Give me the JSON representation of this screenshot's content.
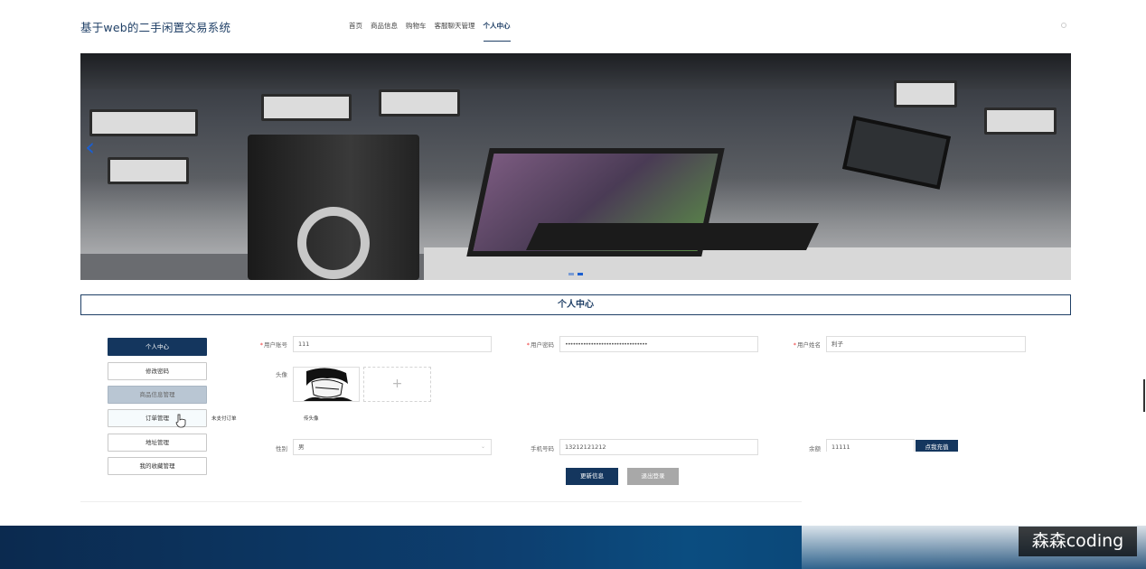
{
  "header": {
    "site_title": "基于web的二手闲置交易系统",
    "nav": [
      {
        "label": "首页"
      },
      {
        "label": "商品信息"
      },
      {
        "label": "购物车"
      },
      {
        "label": "客服聊天管理"
      },
      {
        "label": "个人中心"
      }
    ],
    "active_nav": "个人中心"
  },
  "carousel": {
    "prev_icon": "chevron-left-icon",
    "slide_count": 2,
    "active_slide": 2
  },
  "section": {
    "title": "个人中心"
  },
  "sidebar": {
    "items": [
      {
        "label": "个人中心",
        "state": "active"
      },
      {
        "label": "修改密码",
        "state": "normal"
      },
      {
        "label": "商品信息管理",
        "state": "muted"
      },
      {
        "label": "订单管理",
        "state": "hover"
      },
      {
        "label": "地址管理",
        "state": "normal"
      },
      {
        "label": "我的收藏管理",
        "state": "normal"
      }
    ]
  },
  "form": {
    "account_label": "用户账号",
    "account_value": "111",
    "password_label": "用户密码",
    "password_value": "••••••••••••••••••••••••••••••••",
    "name_label": "用户姓名",
    "name_value": "利子",
    "avatar_label": "头像",
    "upload_icon": "+",
    "unpaid_order_text": "未支付订单",
    "upload_avatar_text": "传头像",
    "gender_label": "性别",
    "gender_value": "男",
    "phone_label": "手机号码",
    "phone_value": "13212121212",
    "balance_label": "余额",
    "balance_value": "11111",
    "recharge_label": "点我充值",
    "update_label": "更新信息",
    "logout_label": "退出登录"
  },
  "watermark": {
    "text": "森森coding"
  },
  "colors": {
    "primary": "#14365e",
    "title": "#1f3f66",
    "muted_button": "#b9c6d3",
    "grey_button": "#a8a8a8",
    "carousel_accent": "#1b5fd0",
    "required": "#ee3333"
  }
}
